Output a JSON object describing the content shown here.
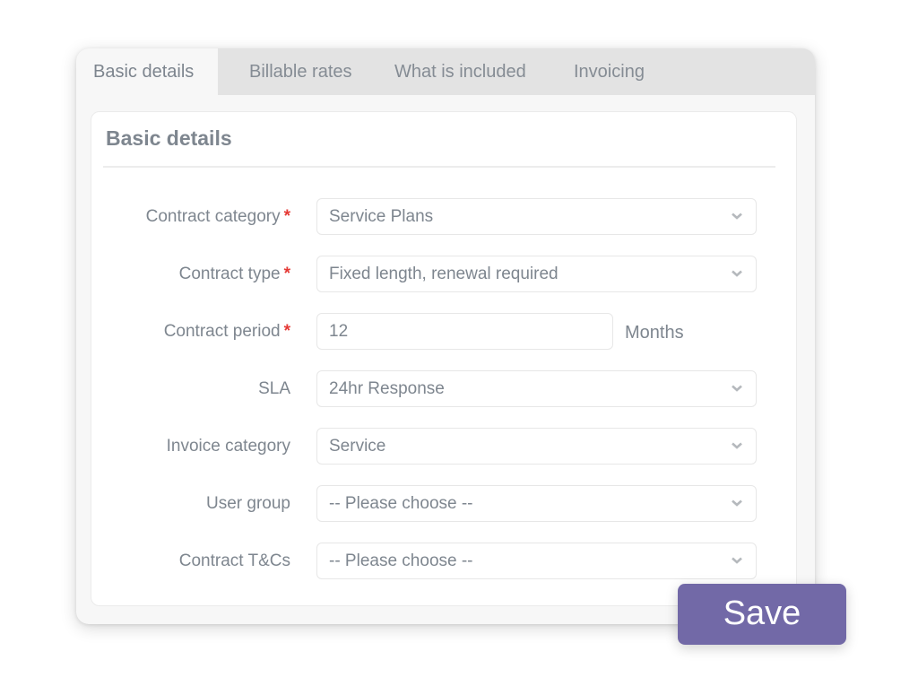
{
  "tabs": [
    {
      "label": "Basic details",
      "active": true
    },
    {
      "label": "Billable rates",
      "active": false
    },
    {
      "label": "What is included",
      "active": false
    },
    {
      "label": "Invoicing",
      "active": false
    }
  ],
  "panel": {
    "title": "Basic details"
  },
  "form": {
    "required_marker": "*",
    "fields": [
      {
        "label": "Contract category",
        "required": true,
        "type": "select",
        "value": "Service Plans",
        "icon": "chevron-down-icon"
      },
      {
        "label": "Contract type",
        "required": true,
        "type": "select",
        "value": "Fixed length, renewal required",
        "icon": "chevron-down-icon"
      },
      {
        "label": "Contract period",
        "required": true,
        "type": "number",
        "value": "12",
        "unit": "Months"
      },
      {
        "label": "SLA",
        "required": false,
        "type": "select",
        "value": "24hr Response",
        "icon": "chevron-down-icon"
      },
      {
        "label": "Invoice category",
        "required": false,
        "type": "select",
        "value": "Service",
        "icon": "chevron-down-icon"
      },
      {
        "label": "User group",
        "required": false,
        "type": "select",
        "value": "-- Please choose --",
        "icon": "chevron-down-icon"
      },
      {
        "label": "Contract T&Cs",
        "required": false,
        "type": "select",
        "value": "-- Please choose --",
        "icon": "chevron-down-icon"
      }
    ]
  },
  "actions": {
    "save_label": "Save",
    "save_color": "#7269a7"
  },
  "colors": {
    "required": "#e53935",
    "text": "#7e868f",
    "tabbar": "#e3e3e3"
  }
}
